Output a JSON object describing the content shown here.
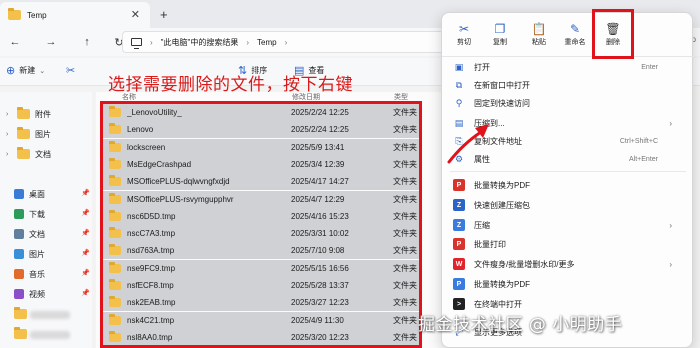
{
  "window": {
    "tab_title": "Temp",
    "new_tab": "+",
    "tab_close": "✕"
  },
  "address": {
    "crumb_search": "\"此电脑\"中的搜索结果",
    "crumb_folder": "Temp",
    "search_peek": "Temp"
  },
  "toolbar": {
    "new_label": "新建",
    "sort_label": "排序",
    "view_label": "查看"
  },
  "caption": "选择需要删除的文件，按下右键",
  "sidebar": {
    "folders": [
      "附件",
      "图片",
      "文档"
    ],
    "quick_access": [
      "桌面",
      "下载",
      "文档",
      "图片",
      "音乐",
      "视频"
    ]
  },
  "filelist": {
    "header_name": "名称",
    "header_date": "修改日期",
    "header_type": "类型",
    "rows": [
      {
        "name": "_LenovoUtility_",
        "date": "2025/2/24 12:25",
        "type": "文件夹"
      },
      {
        "name": "Lenovo",
        "date": "2025/2/24 12:25",
        "type": "文件夹"
      },
      {
        "name": "lockscreen",
        "date": "2025/5/9 13:41",
        "type": "文件夹"
      },
      {
        "name": "MsEdgeCrashpad",
        "date": "2025/3/4 12:39",
        "type": "文件夹"
      },
      {
        "name": "MSOfficePLUS-dqlwvngfxdjd",
        "date": "2025/4/17 14:27",
        "type": "文件夹"
      },
      {
        "name": "MSOfficePLUS-rsvymgupphvr",
        "date": "2025/4/7 12:29",
        "type": "文件夹"
      },
      {
        "name": "nsc6D5D.tmp",
        "date": "2025/4/16 15:23",
        "type": "文件夹"
      },
      {
        "name": "nscC7A3.tmp",
        "date": "2025/3/31 10:02",
        "type": "文件夹"
      },
      {
        "name": "nsd763A.tmp",
        "date": "2025/7/10 9:08",
        "type": "文件夹"
      },
      {
        "name": "nse9FC9.tmp",
        "date": "2025/5/15 16:56",
        "type": "文件夹"
      },
      {
        "name": "nsfECF8.tmp",
        "date": "2025/5/28 13:37",
        "type": "文件夹"
      },
      {
        "name": "nsk2EAB.tmp",
        "date": "2025/3/27 12:23",
        "type": "文件夹"
      },
      {
        "name": "nsk4C21.tmp",
        "date": "2025/4/9 11:30",
        "type": "文件夹"
      },
      {
        "name": "nsl8AA0.tmp",
        "date": "2025/3/20 12:23",
        "type": "文件夹"
      }
    ]
  },
  "context_menu": {
    "top_actions": [
      {
        "label": "剪切",
        "icon": "scissors-icon"
      },
      {
        "label": "复制",
        "icon": "copy-icon"
      },
      {
        "label": "粘贴",
        "icon": "paste-icon"
      },
      {
        "label": "重命名",
        "icon": "rename-icon"
      },
      {
        "label": "删除",
        "icon": "trash-icon"
      }
    ],
    "items": [
      {
        "label": "打开",
        "shortcut": "Enter"
      },
      {
        "label": "在新窗口中打开",
        "shortcut": ""
      },
      {
        "label": "固定到快速访问",
        "shortcut": ""
      },
      {
        "label": "压缩到...",
        "shortcut": ""
      },
      {
        "label": "复制文件地址",
        "shortcut": "Ctrl+Shift+C"
      },
      {
        "label": "属性",
        "shortcut": "Alt+Enter"
      },
      {
        "label": "批量转换为PDF",
        "shortcut": ""
      },
      {
        "label": "快速创建压缩包",
        "shortcut": ""
      },
      {
        "label": "压缩",
        "shortcut": ""
      },
      {
        "label": "批量打印",
        "shortcut": ""
      },
      {
        "label": "文件瘦身/批量增删水印/更多",
        "shortcut": ""
      },
      {
        "label": "批量转换为PDF",
        "shortcut": ""
      },
      {
        "label": "在终端中打开",
        "shortcut": ""
      },
      {
        "label": "显示更多选项",
        "shortcut": ""
      }
    ]
  },
  "watermark": "掘金技术社区 @ 小明助手",
  "colors": {
    "highlight_red": "#e0121b",
    "accent_blue": "#2b63c6",
    "folder_yellow": "#f3c14b",
    "selected_row": "#cfd1d4"
  }
}
